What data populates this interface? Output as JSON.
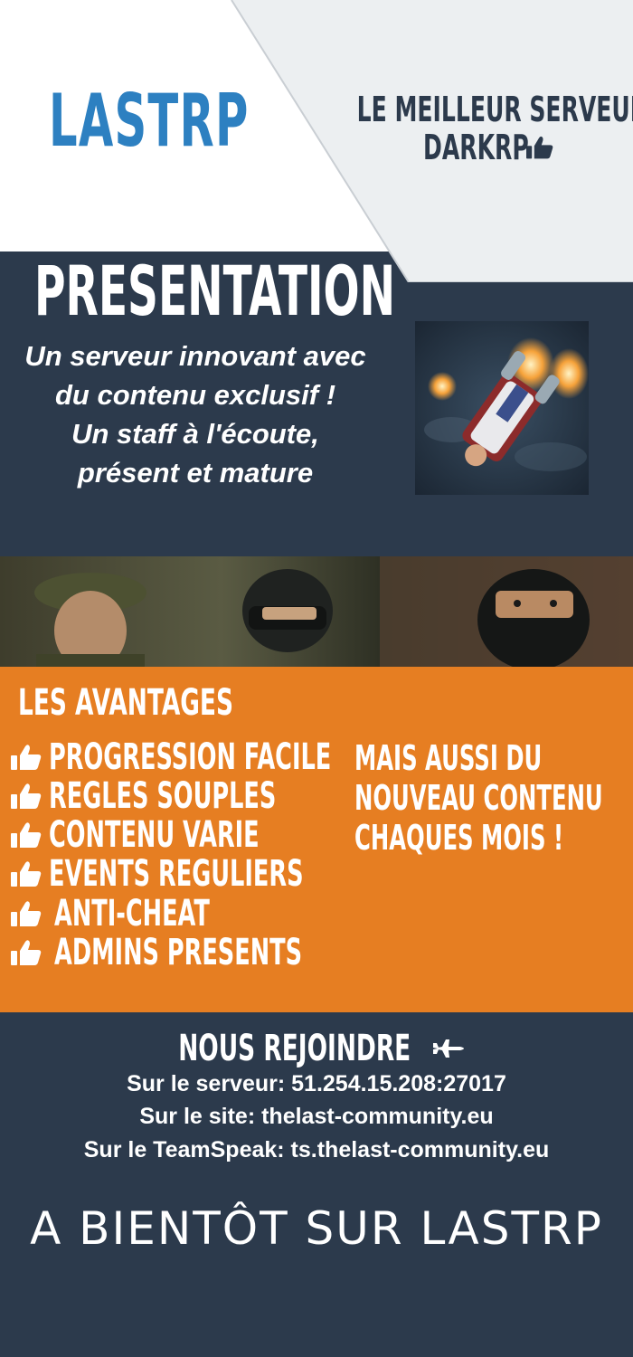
{
  "header": {
    "logo_text": "LASTRP",
    "tagline_line1": "LE MEILLEUR SERVEUR",
    "tagline_line2": "DARKRP"
  },
  "presentation": {
    "title": "PRESENTATION",
    "lines": [
      "Un serveur innovant avec",
      "du contenu exclusif !",
      "Un staff à l'écoute,",
      "présent et mature"
    ]
  },
  "advantages": {
    "title": "LES AVANTAGES",
    "items": [
      "PROGRESSION FACILE",
      "REGLES SOUPLES",
      "CONTENU VARIE",
      "EVENTS REGULIERS",
      "ANTI-CHEAT",
      "ADMINS PRESENTS"
    ],
    "also_lines": [
      "MAIS AUSSI DU",
      "NOUVEAU CONTENU",
      "CHAQUES MOIS !"
    ]
  },
  "join": {
    "title": "NOUS REJOINDRE",
    "server": "Sur le serveur: 51.254.15.208:27017",
    "site": "Sur le site: thelast-community.eu",
    "teamspeak": "Sur le TeamSpeak: ts.thelast-community.eu"
  },
  "footer": {
    "goodbye": "A BIENTÔT SUR LASTRP"
  },
  "icons": {
    "thumbs_up": "thumbs-up-icon",
    "plane": "plane-icon"
  },
  "colors": {
    "navy": "#2c3a4c",
    "orange": "#e67e22",
    "logo_blue": "#2d80c1",
    "light_panel": "#eceff1"
  }
}
